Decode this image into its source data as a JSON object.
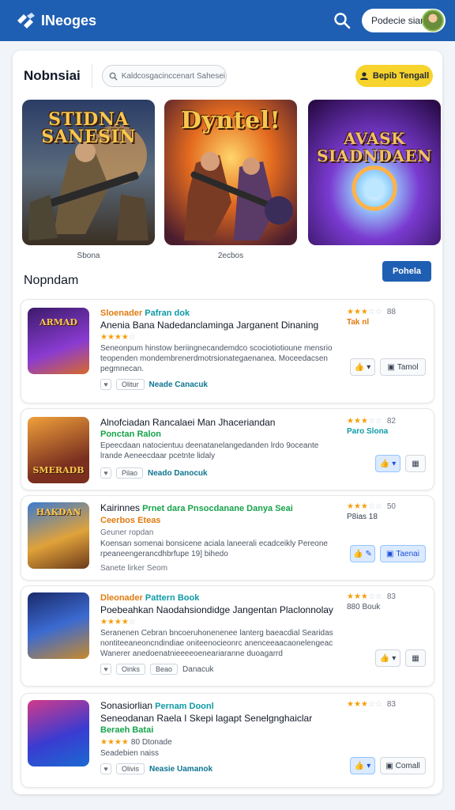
{
  "header": {
    "logo_text": "INeoges",
    "profile_label": "Podecie sian",
    "colors": {
      "bar": "#1f5fb3"
    }
  },
  "panel": {
    "title": "Nobnsiai",
    "search_placeholder": "Kaldcosgacinccenart Sahesei",
    "primary_action": "Bepib Tengall"
  },
  "featured": [
    {
      "title": "STIDNA SANESIN",
      "caption": "Sbona"
    },
    {
      "title": "Dyntel!",
      "caption": "2ecbos"
    },
    {
      "title": "AVASK SIADNDAEN",
      "caption": ""
    }
  ],
  "section": {
    "title": "Nopndam",
    "button": "Pohela"
  },
  "items": [
    {
      "thumb_title": "ARMAD",
      "meta_a": "Sloenader",
      "meta_b": "Pafran dok",
      "name": "Anenia Bana Nadedanclaminga Jarganent Dinaning",
      "stars": 4,
      "desc": "Seneonpum hinstow beriingnecandemdco scociotiotioune mensrio teopenden mondembrenerdmotrsionategaenanea. Moceedacsen pegmnecan.",
      "tag_pill": "Olitur",
      "tag_link": "Neade Canacuk",
      "rating": 3,
      "rating_value": "88",
      "rating_sub": "Tak nl",
      "btn_label": "Tamol",
      "active": false
    },
    {
      "thumb_title": "SMERADB",
      "meta_a": "",
      "meta_b": "",
      "name": "Alnofciadan Rancalaei Man Jhaceriandan",
      "stars": 0,
      "sub_line": "Ponctan Ralon",
      "desc": "Epeecdaan natocientuu deenatanelangedanden lrdo 9oceante lrande Aeneecdaar pcetnte lidaly",
      "tag_pill": "Pilao",
      "tag_link": "Neado Danocuk",
      "rating": 3,
      "rating_value": "82",
      "rating_sub": "Paro Slona",
      "btn_label": "",
      "active": true
    },
    {
      "thumb_title": "HAKDAN",
      "meta_a": "Kairinnes",
      "meta_b": "Prnet dara Pnsocdanane Danya Seai",
      "name": "",
      "stars": 0,
      "sub_line": "Ceerbos Eteas",
      "sub_line2": "Geuner ropdan",
      "desc": "Koensan somenai bonsicene aciala laneerali ecadceikly Pereone rpeaneengerancdhbrfupe 19] bihedo",
      "tag_pill": "",
      "tag_link": "Sanete lirker  Seom",
      "rating": 3,
      "rating_value": "50",
      "rating_sub": "P8ias 18",
      "btn_label": "Taenai",
      "active": true
    },
    {
      "thumb_title": "",
      "meta_a": "Dleonader",
      "meta_b": "Pattern Book",
      "name": "Poebeahkan Naodahsiondidge Jangentan Placlonnolay",
      "stars": 4,
      "desc": "Seranenen Cebran bncoeruhonenenee lanterg baeacdial Searidas nontiteeaneoncndindiae oniteenocieonrc anenceeaacaonelengeac Wanerer anedoenatnieeeeoeneariaranne duoagarrd",
      "tag_pill": "Oinks",
      "tag_link2": "Beao",
      "tag_link": "Danacuk",
      "rating": 3,
      "rating_value": "83",
      "rating_sub": "880 Bouk",
      "btn_label": "",
      "active": false
    },
    {
      "thumb_title": "",
      "meta_a": "Sonasiorlian",
      "meta_b": "Pernam Doonl",
      "name": "Seneodanan Raela I Skepi lagapt Senelgnghaiclar",
      "stars": 4,
      "sub_line": "Beraeh Batai",
      "sub_line3": "80 Dtonade",
      "desc": "Seadebien naiss",
      "tag_pill": "Olivis",
      "tag_link": "Neasie Uamanok",
      "rating": 3,
      "rating_value": "83",
      "rating_sub": "",
      "btn_label": "Comall",
      "active": true
    }
  ]
}
